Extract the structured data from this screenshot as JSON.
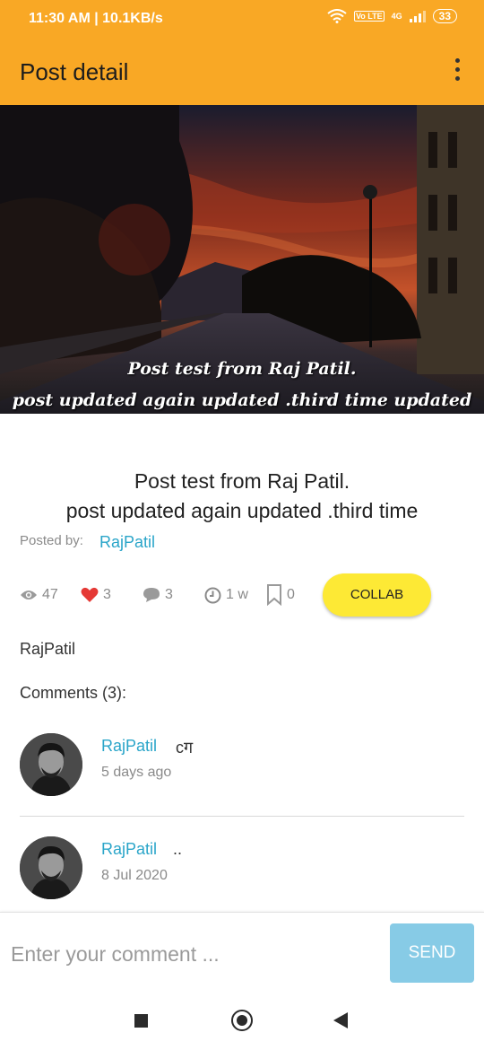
{
  "status_bar": {
    "time": "11:30 AM | 10.1KB/s",
    "volte": "Vo LTE",
    "network": "4G",
    "battery": "33"
  },
  "app_bar": {
    "title": "Post detail"
  },
  "hero": {
    "caption_line1": "Post test from Raj Patil.",
    "caption_line2": "post  updated again updated .third time updated"
  },
  "post": {
    "title_line1": "Post test from Raj Patil.",
    "title_line2": "post  updated again updated .third time",
    "posted_by_label": "Posted by:",
    "author": "RajPatil"
  },
  "stats": {
    "views": "47",
    "likes": "3",
    "comments": "3",
    "age": "1 w",
    "bookmarks": "0",
    "collab_label": "COLLAB"
  },
  "author_plain": "RajPatil",
  "comments_heading": "Comments (3):",
  "comments": [
    {
      "user": "RajPatil",
      "text": "cग",
      "time": "5 days ago"
    },
    {
      "user": "RajPatil",
      "text": "..",
      "time": "8 Jul 2020"
    }
  ],
  "comment_box": {
    "placeholder": "Enter your comment ...",
    "send_label": "SEND"
  },
  "colors": {
    "accent": "#f9a825",
    "link": "#2aa5c9",
    "collab": "#fde935",
    "send": "#87cbe6"
  }
}
